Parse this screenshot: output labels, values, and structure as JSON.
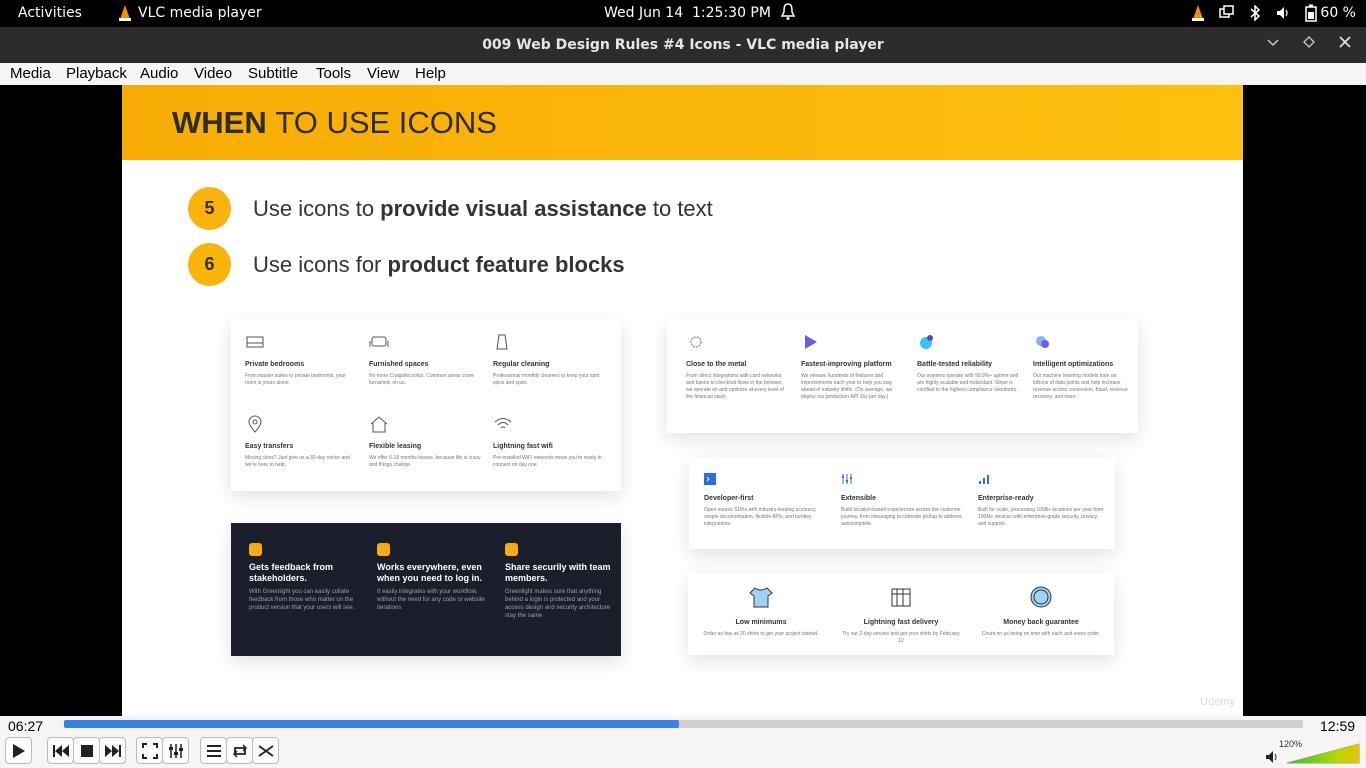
{
  "topbar": {
    "activities": "Activities",
    "app": "VLC media player",
    "clock": "Wed Jun 14  1:25:30 PM",
    "battery": "60 %"
  },
  "window": {
    "title": "009 Web Design Rules #4 Icons - VLC media player"
  },
  "menu": [
    "Media",
    "Playback",
    "Audio",
    "Video",
    "Subtitle",
    "Tools",
    "View",
    "Help"
  ],
  "slide": {
    "title_bold": "WHEN",
    "title_rest": "TO USE ICONS",
    "points": [
      {
        "num": "5",
        "pre": "Use icons to ",
        "bold": "provide visual assistance",
        "post": " to text"
      },
      {
        "num": "6",
        "pre": "Use icons for ",
        "bold": "product feature blocks",
        "post": ""
      }
    ],
    "card1": [
      {
        "t": "Private bedrooms",
        "d": "From master suites to private bedrooms, your room is yours alone."
      },
      {
        "t": "Furnished spaces",
        "d": "No more Craigslist sofas. Common areas come furnished, on us."
      },
      {
        "t": "Regular cleaning",
        "d": "Professional monthly cleaners to keep your spot spick and span."
      },
      {
        "t": "Easy transfers",
        "d": "Moving cities? Just give us a 30-day notice and we're here to help."
      },
      {
        "t": "Flexible leasing",
        "d": "We offer 6-18 months leases, because life is crazy and things change."
      },
      {
        "t": "Lightning fast wifi",
        "d": "Pre-installed WiFi networks mean you're ready to connect on day one."
      }
    ],
    "card2": [
      {
        "t": "Gets feedback from stakeholders.",
        "d": "With Greenlight you can easily collate feedback from those who matter on the product version that your users will see."
      },
      {
        "t": "Works everywhere, even when you need to log in.",
        "d": "It easily integrates with your workflow, without the need for any code or website iterations"
      },
      {
        "t": "Share securily with team members.",
        "d": "Greenlight makes sure that anything behind a login is protected and your access design and security architecture stay the same"
      }
    ],
    "card3": [
      {
        "t": "Close to the metal",
        "d": "From direct integrations with card networks and banks to checkout flows in the browser, we operate on and optimize at every level of the financial stack."
      },
      {
        "t": "Fastest-improving platform",
        "d": "We release hundreds of features and improvements each year to help you stay ahead of industry shifts. (On average, we deploy our production API 16x per day.)"
      },
      {
        "t": "Battle-tested reliability",
        "d": "Our systems operate with 99.9%+ uptime and are highly scalable and redundant. Stripe is certified to the highest compliance standards."
      },
      {
        "t": "Intelligent optimizations",
        "d": "Our machine learning models train on billions of data points and help increase revenue across conversion, fraud, revenue recovery, and more."
      }
    ],
    "card4": [
      {
        "t": "Developer-first",
        "d": "Open-source SDKs with industry-leading accuracy, simple documentation, flexible APIs, and turnkey integrations."
      },
      {
        "t": "Extensible",
        "d": "Build location-based experiences across the customer journey, from messaging to curbside pickup to address autocomplete."
      },
      {
        "t": "Enterprise-ready",
        "d": "Built for scale, processing 100B+ locations per year from 100M+ devices with enterprise-grade security, privacy, and support."
      }
    ],
    "card5": [
      {
        "t": "Low minimums",
        "d": "Order as few as 20 shirts to get your project started."
      },
      {
        "t": "Lightning fast delivery",
        "d": "Try our 2-day service and get your shirts by February 12"
      },
      {
        "t": "Money back guarantee",
        "d": "Count on us being on time with each and every order."
      }
    ],
    "watermark": "Udemy"
  },
  "player": {
    "elapsed": "06:27",
    "total": "12:59",
    "progress": 0.496,
    "volume": "120%"
  },
  "colors": {
    "accent": "#3584e4",
    "banner": "#f8ab06",
    "badge": "#f8b40a"
  }
}
